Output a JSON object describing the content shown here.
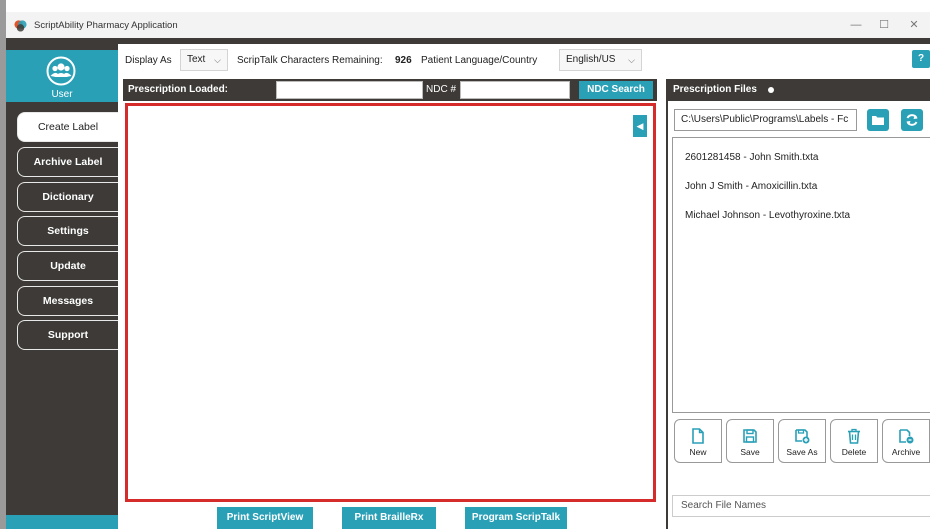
{
  "window": {
    "title": "ScriptAbility Pharmacy Application",
    "controls": {
      "minimize": "—",
      "maximize": "☐",
      "close": "✕"
    }
  },
  "sidebar": {
    "user_label": "User",
    "items": [
      {
        "label": "Create Label",
        "active": true
      },
      {
        "label": "Archive Label",
        "active": false
      },
      {
        "label": "Dictionary",
        "active": false
      },
      {
        "label": "Settings",
        "active": false
      },
      {
        "label": "Update",
        "active": false
      },
      {
        "label": "Messages",
        "active": false
      },
      {
        "label": "Support",
        "active": false
      }
    ]
  },
  "options": {
    "display_as_label": "Display As",
    "display_as_value": "Text",
    "chars_remaining_label": "ScripTalk Characters Remaining:",
    "chars_remaining_value": "926",
    "language_label": "Patient Language/Country",
    "language_value": "English/US",
    "help": "?"
  },
  "rxbar": {
    "loaded_label": "Prescription Loaded:",
    "loaded_value": "",
    "ndc_label": "NDC #",
    "ndc_value": "",
    "ndc_search": "NDC Search"
  },
  "bottom_buttons": {
    "print_scriptview": "Print ScriptView",
    "print_braillerx": "Print BrailleRx",
    "program_scriptalk": "Program ScripTalk"
  },
  "files_panel": {
    "title": "Prescription Files",
    "path": "C:\\Users\\Public\\Programs\\Labels - Fc",
    "files": [
      "2601281458 - John Smith.txta",
      "John J Smith - Amoxicillin.txta",
      "Michael Johnson - Levothyroxine.txta"
    ],
    "tools": {
      "new": "New",
      "save": "Save",
      "save_as": "Save As",
      "delete": "Delete",
      "archive": "Archive"
    },
    "search_placeholder": "Search File Names"
  },
  "colors": {
    "accent": "#2aa0b7",
    "dark": "#3d3a37",
    "editor_border": "#d62b2b"
  }
}
